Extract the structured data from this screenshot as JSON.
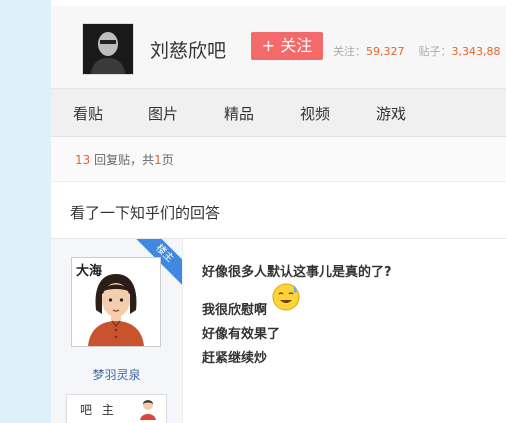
{
  "forum": {
    "name": "刘慈欣吧",
    "follow_label": "+ 关注",
    "followers_label": "关注：",
    "followers_count": "59,327",
    "posts_label": "贴子：",
    "posts_count": "3,343,88"
  },
  "nav": {
    "items": [
      {
        "label": "看贴"
      },
      {
        "label": "图片"
      },
      {
        "label": "精品"
      },
      {
        "label": "视频"
      },
      {
        "label": "游戏"
      }
    ]
  },
  "reply_info": {
    "count": "13",
    "text_mid": " 回复贴，共",
    "pages": "1",
    "text_end": "页"
  },
  "thread": {
    "title": "看了一下知乎们的回答"
  },
  "post": {
    "ribbon_label": "楼主",
    "author_name": "梦羽灵泉",
    "badge_label": "吧 主",
    "lines": [
      "好像很多人默认这事儿是真的了?",
      "我很欣慰啊",
      "好像有效果了",
      "赶紧继续炒"
    ],
    "emoji": "sweat-smile-emoji",
    "avatar_text": "大海"
  },
  "colors": {
    "accent": "#e8632e",
    "follow_button": "#f36a6a",
    "ribbon": "#3f8ae0",
    "author_link": "#3d6aa6"
  }
}
